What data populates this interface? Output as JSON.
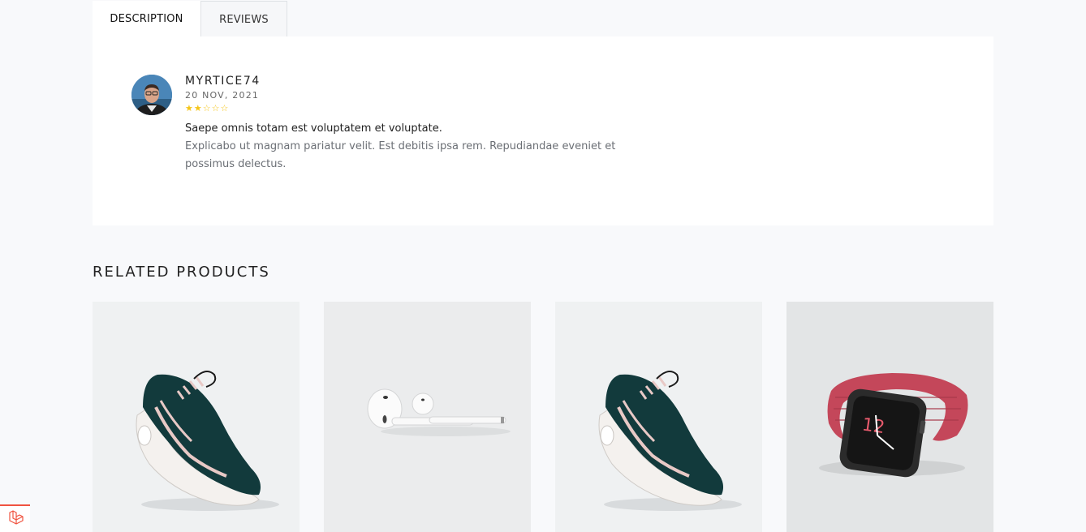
{
  "tabs": [
    {
      "label": "DESCRIPTION",
      "active": true
    },
    {
      "label": "REVIEWS",
      "active": false
    }
  ],
  "review": {
    "reviewer": "MYRTICE74",
    "date": "20 NOV, 2021",
    "rating": 2,
    "rating_max": 5,
    "title": "Saepe omnis totam est voluptatem et voluptate.",
    "text": "Explicabo ut magnam pariatur velit. Est debitis ipsa rem. Repudiandae eveniet et possimus delectus."
  },
  "related": {
    "heading": "RELATED PRODUCTS",
    "products": [
      {
        "image": "sneaker-image"
      },
      {
        "image": "airpods-image"
      },
      {
        "image": "sneaker-image"
      },
      {
        "image": "smartwatch-image"
      }
    ]
  },
  "colors": {
    "star": "#f5c518",
    "badge_accent": "#f05340"
  }
}
